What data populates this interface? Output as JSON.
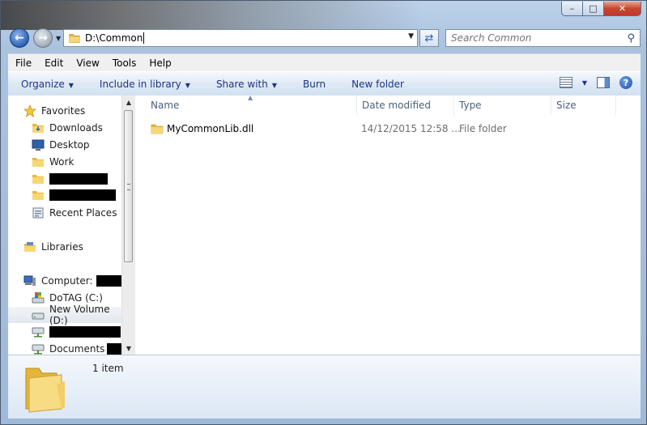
{
  "window": {
    "caption": {
      "minimize": "–",
      "maximize": "□",
      "close": "✕"
    }
  },
  "address_bar": {
    "path": "D:\\Common"
  },
  "search": {
    "placeholder": "Search Common"
  },
  "menu": [
    "File",
    "Edit",
    "View",
    "Tools",
    "Help"
  ],
  "toolbar": {
    "organize": "Organize",
    "include_in_library": "Include in library",
    "share_with": "Share with",
    "burn": "Burn",
    "new_folder": "New folder"
  },
  "nav_pane": {
    "favorites_header": "Favorites",
    "favorites": [
      {
        "label": "Downloads",
        "icon": "folder-icon"
      },
      {
        "label": "Desktop",
        "icon": "desktop-icon"
      },
      {
        "label": "Work",
        "icon": "folder-icon"
      },
      {
        "label": "",
        "icon": "folder-icon",
        "redacted": true
      },
      {
        "label": "",
        "icon": "folder-icon",
        "redacted": true
      },
      {
        "label": "Recent Places",
        "icon": "recent-places-icon"
      }
    ],
    "libraries": "Libraries",
    "computer": "Computer:",
    "drives": [
      {
        "label": "DoTAG (C:)",
        "icon": "system-drive-icon"
      },
      {
        "label": "New Volume (D:)",
        "icon": "drive-icon",
        "selected": true
      },
      {
        "label": "",
        "icon": "network-drive-icon",
        "redacted": true
      },
      {
        "label": "Documents",
        "icon": "network-drive-icon"
      }
    ]
  },
  "columns": {
    "name": "Name",
    "date_modified": "Date modified",
    "type": "Type",
    "size": "Size"
  },
  "files": [
    {
      "name": "MyCommonLib.dll",
      "date_modified": "14/12/2015 12:58 ...",
      "type": "File folder",
      "size": ""
    }
  ],
  "details_pane": {
    "count": "1 item"
  },
  "colors": {
    "accent": "#1e3287",
    "folder": "#f1c54a",
    "window_frame": "#a9c2de"
  }
}
